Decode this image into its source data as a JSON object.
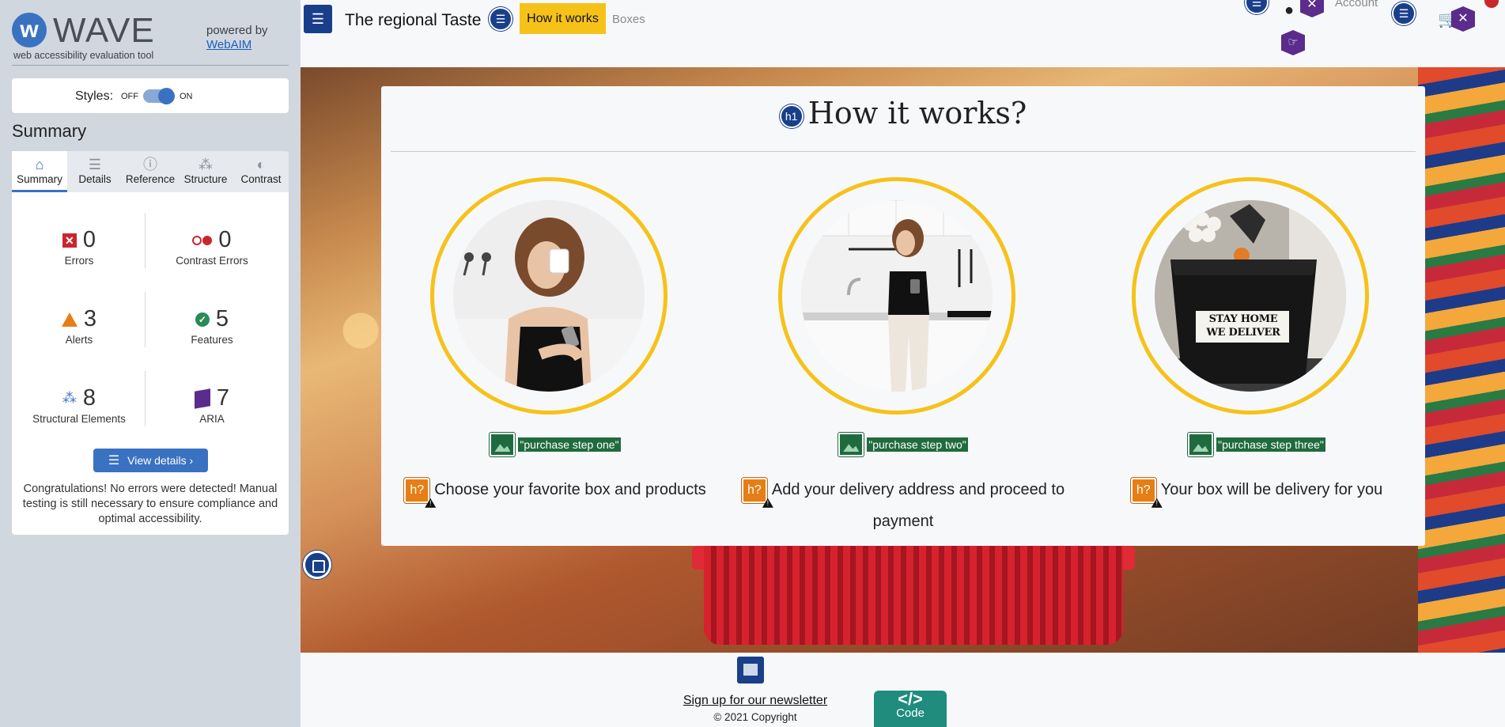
{
  "wave": {
    "logo_letter": "w",
    "name": "WAVE",
    "tagline": "web accessibility evaluation tool",
    "powered_by": "powered by",
    "webaim": "WebAIM",
    "styles_label": "Styles:",
    "off": "OFF",
    "on": "ON",
    "summary_title": "Summary",
    "tabs": [
      {
        "label": "Summary",
        "icon": "home-icon",
        "glyph": "⌂"
      },
      {
        "label": "Details",
        "icon": "list-icon",
        "glyph": "☰"
      },
      {
        "label": "Reference",
        "icon": "info-icon",
        "glyph": "ⓘ"
      },
      {
        "label": "Structure",
        "icon": "hierarchy-icon",
        "glyph": "⁂"
      },
      {
        "label": "Contrast",
        "icon": "contrast-icon",
        "glyph": "◐"
      }
    ],
    "stats": {
      "errors": {
        "value": "0",
        "label": "Errors"
      },
      "contrast_errors": {
        "value": "0",
        "label": "Contrast Errors"
      },
      "alerts": {
        "value": "3",
        "label": "Alerts"
      },
      "features": {
        "value": "5",
        "label": "Features"
      },
      "structural": {
        "value": "8",
        "label": "Structural Elements"
      },
      "aria": {
        "value": "7",
        "label": "ARIA"
      }
    },
    "view_details": "View details ›",
    "congrats": "Congratulations! No errors were detected! Manual testing is still necessary to ensure compliance and optimal accessibility."
  },
  "site": {
    "brand": "The regional Taste",
    "nav": {
      "how_it_works": "How it works",
      "boxes": "Boxes",
      "account": "Account"
    },
    "heading": "How it works?",
    "h1_badge": "h1",
    "steps": [
      {
        "alt": "\"purchase step one\"",
        "text": "Choose your favorite box and products"
      },
      {
        "alt": "\"purchase step two\"",
        "text": "Add your delivery address and proceed to payment"
      },
      {
        "alt": "\"purchase step three\"",
        "text": "Your box will be delivery for you"
      }
    ],
    "bag_text": "STAY HOME WE DELIVER",
    "hq": "h?",
    "footer": {
      "newsletter": "Sign up for our newsletter",
      "copyright": "© 2021 Copyright"
    },
    "code_badge": {
      "brackets": "</>",
      "label": "Code"
    }
  },
  "colors": {
    "wave_blue": "#3a72c2",
    "yellow": "#f6c21a",
    "error_red": "#c9272d",
    "alert_orange": "#e67e15",
    "feature_green": "#2a8a55",
    "aria_purple": "#5b2c8b"
  }
}
